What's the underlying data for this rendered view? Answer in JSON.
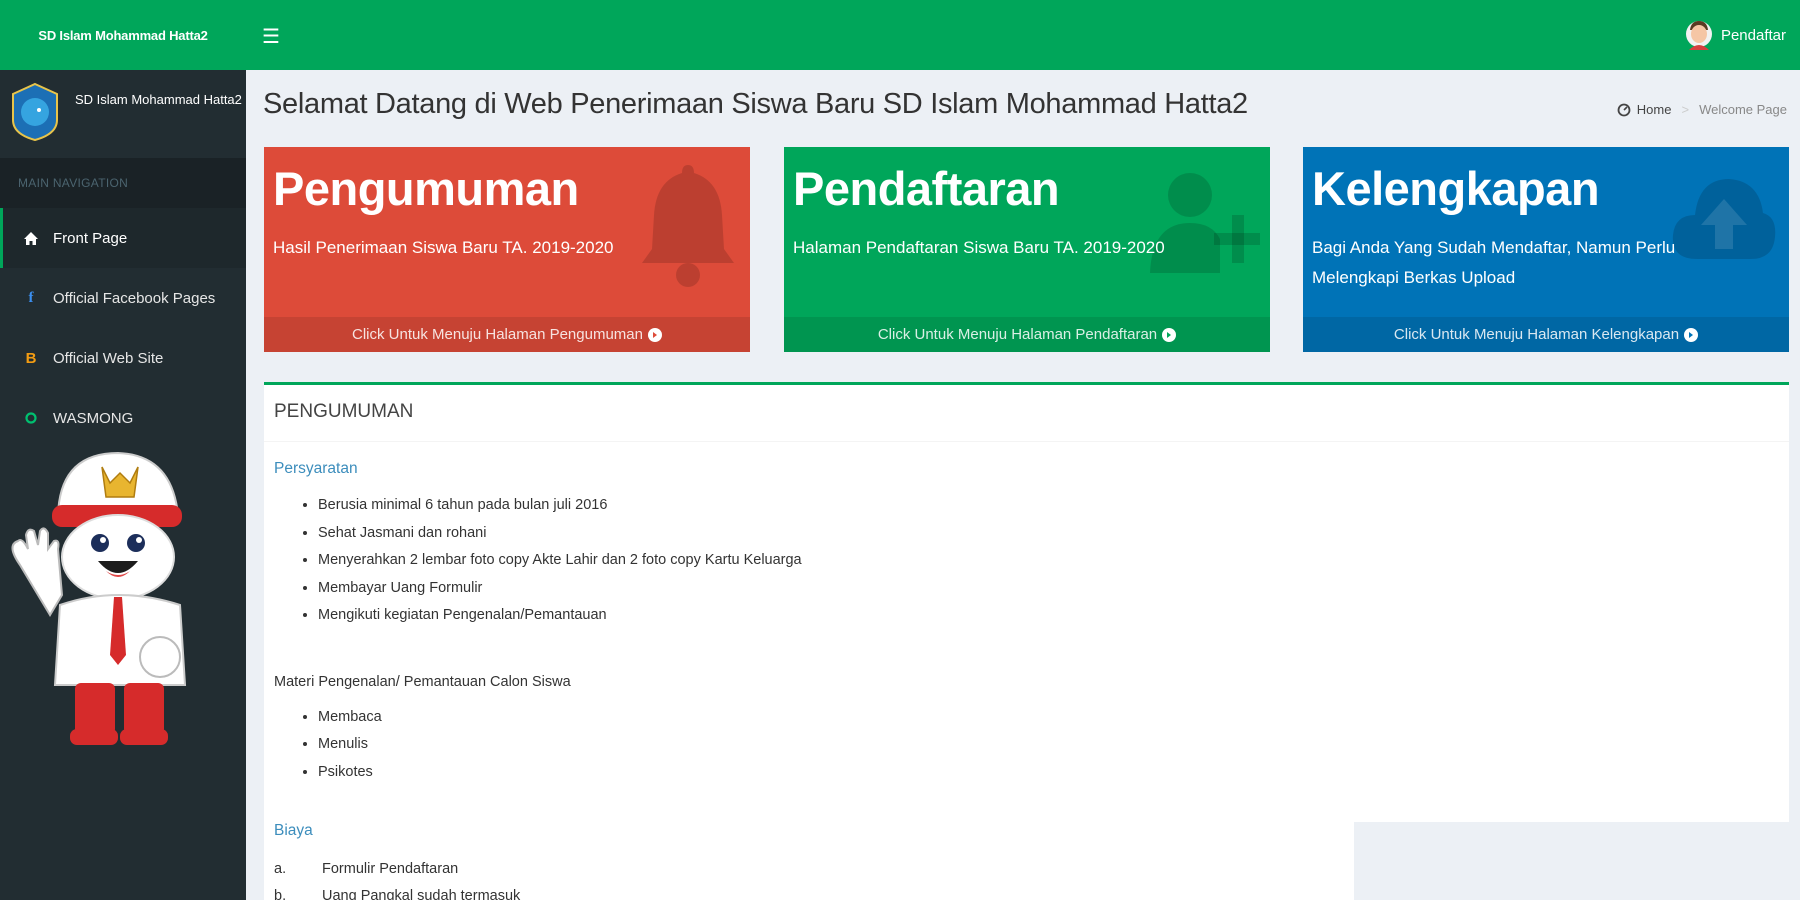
{
  "app": {
    "logo_title": "SD Islam Mohammad Hatta2",
    "school_name": "SD Islam Mohammad Hatta2"
  },
  "sidebar": {
    "nav_header": "MAIN NAVIGATION",
    "items": [
      {
        "label": "Front Page",
        "icon": "home-icon"
      },
      {
        "label": "Official Facebook Pages",
        "icon": "facebook-icon"
      },
      {
        "label": "Official Web Site",
        "icon": "blogger-icon"
      },
      {
        "label": "WASMONG",
        "icon": "circle-icon"
      }
    ]
  },
  "header": {
    "menu_icon": "hamburger-icon",
    "user_label": "Pendaftar"
  },
  "content": {
    "title": "Selamat Datang di Web Penerimaan Siswa Baru SD Islam Mohammad Hatta2",
    "breadcrumb": {
      "home": "Home",
      "current": "Welcome Page"
    }
  },
  "boxes": [
    {
      "title": "Pengumuman",
      "text": "Hasil Penerimaan Siswa Baru TA. 2019-2020",
      "footer": "Click Untuk Menuju Halaman Pengumuman",
      "icon": "bell-icon",
      "color": "#dd4b39"
    },
    {
      "title": "Pendaftaran",
      "text": "Halaman Pendaftaran Siswa Baru TA. 2019-2020",
      "footer": "Click Untuk Menuju Halaman Pendaftaran",
      "icon": "user-plus-icon",
      "color": "#00a65a"
    },
    {
      "title": "Kelengkapan",
      "text": "Bagi Anda Yang Sudah Mendaftar, Namun Perlu Melengkapi Berkas Upload",
      "footer": "Click Untuk Menuju Halaman Kelengkapan",
      "icon": "cloud-upload-icon",
      "color": "#0073b7"
    }
  ],
  "announcement": {
    "heading": "PENGUMUMAN",
    "requirements_title": "Persyaratan",
    "requirements": [
      "Berusia minimal 6 tahun pada bulan juli 2016",
      "Sehat Jasmani dan rohani",
      "Menyerahkan 2 lembar foto copy Akte Lahir dan 2 foto copy Kartu Keluarga",
      "Membayar Uang Formulir",
      "Mengikuti kegiatan Pengenalan/Pemantauan"
    ],
    "material_title": "Materi Pengenalan/ Pemantauan Calon Siswa",
    "materials": [
      "Membaca",
      "Menulis",
      "Psikotes"
    ],
    "cost_title": "Biaya",
    "costs": [
      {
        "label": "a.",
        "text": "Formulir Pendaftaran"
      },
      {
        "label": "b.",
        "text": "Uang Pangkal sudah termasuk"
      }
    ]
  },
  "colors": {
    "primary": "#00a65a",
    "sidebar": "#222d32",
    "link": "#3c8dbc"
  }
}
